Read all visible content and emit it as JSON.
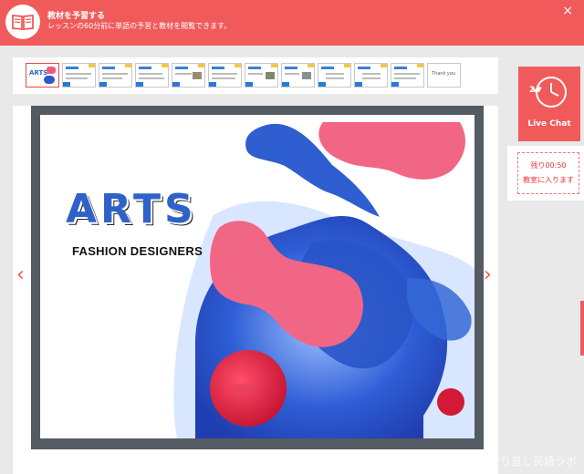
{
  "header": {
    "title": "教材を予習する",
    "subtitle": "レッスンの60分前に単語の予習と教材を閲覧できます。",
    "close_label": "×"
  },
  "thumbnails": {
    "count": 12,
    "active_index": 0,
    "first_label": "ARTS",
    "last_label": "Thank you"
  },
  "slide": {
    "title": "ARTS",
    "subtitle": "FASHION DESIGNERS"
  },
  "nav": {
    "prev": "‹",
    "next": "›"
  },
  "live_chat": {
    "icon_number": "24",
    "label": "Live Chat"
  },
  "enter_room": {
    "remaining": "残り00:50",
    "label": "教室に入ります"
  },
  "watermark": "大人からのやり直し英語ラボ",
  "colors": {
    "accent": "#f15a5a",
    "frame": "#555b62",
    "background": "#e9e9e9"
  }
}
